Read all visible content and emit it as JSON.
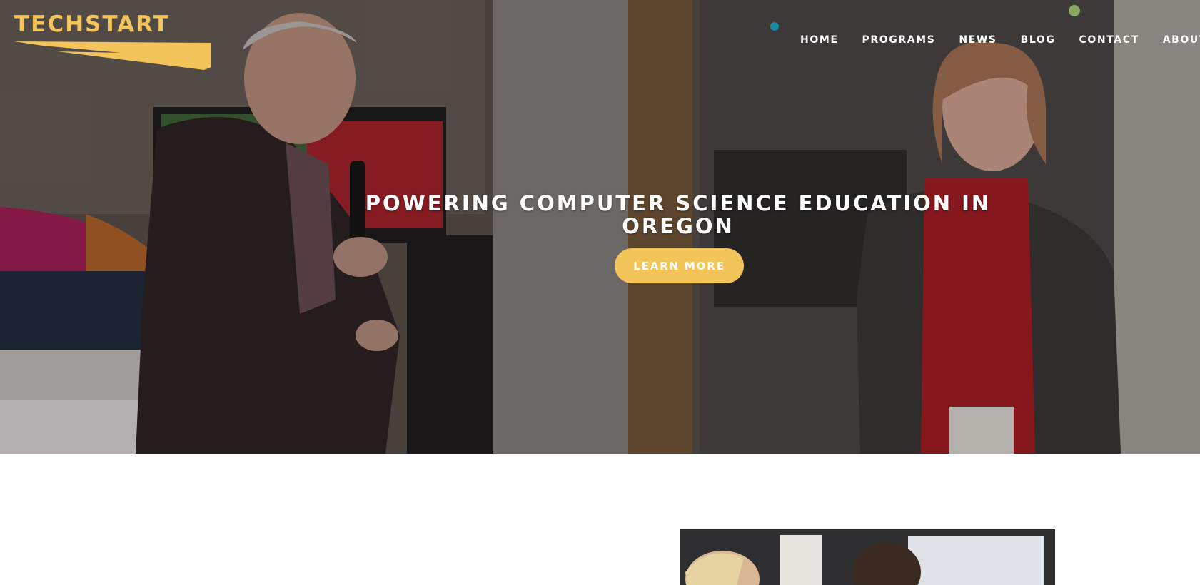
{
  "brand": {
    "logo_text": "TECHSTART",
    "accent": "#f2c45a"
  },
  "nav": {
    "items": [
      {
        "label": "HOME"
      },
      {
        "label": "PROGRAMS"
      },
      {
        "label": "NEWS"
      },
      {
        "label": "BLOG"
      },
      {
        "label": "CONTACT"
      },
      {
        "label": "ABOUT"
      }
    ]
  },
  "hero": {
    "headline_line1": "POWERING COMPUTER SCIENCE EDUCATION IN",
    "headline_line2": "OREGON",
    "cta_label": "LEARN MORE"
  },
  "icons": {
    "logo_swoosh": "logo-swoosh-icon"
  }
}
